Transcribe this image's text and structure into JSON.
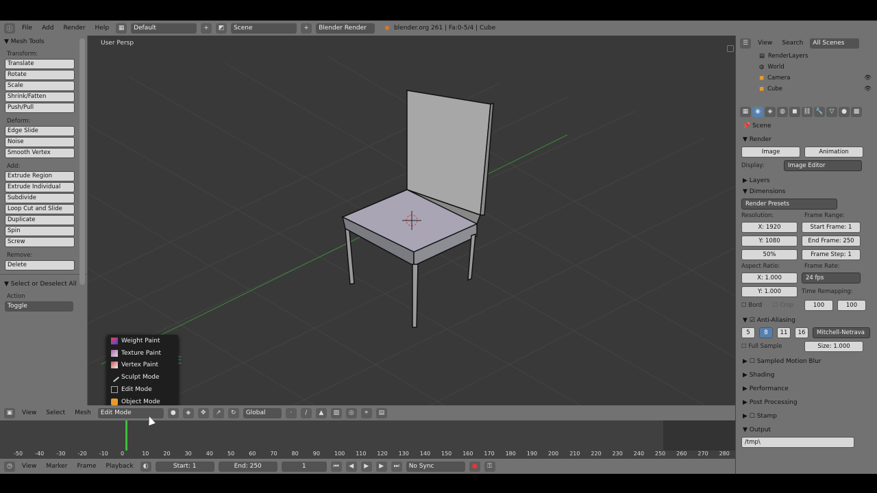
{
  "topbar": {
    "menus": [
      "File",
      "Add",
      "Render",
      "Help"
    ],
    "screen_layout": "Default",
    "scene": "Scene",
    "engine": "Blender Render",
    "info": "blender.org 261 | Fa:0-5/4 | Cube"
  },
  "toolshelf": {
    "title": "Mesh Tools",
    "transform_label": "Transform:",
    "transform": [
      "Translate",
      "Rotate",
      "Scale",
      "Shrink/Fatten",
      "Push/Pull"
    ],
    "deform_label": "Deform:",
    "deform": [
      "Edge Slide",
      "Noise",
      "Smooth Vertex"
    ],
    "add_label": "Add:",
    "add": [
      "Extrude Region",
      "Extrude Individual",
      "Subdivide",
      "Loop Cut and Slide",
      "Duplicate",
      "Spin",
      "Screw"
    ],
    "remove_label": "Remove:",
    "remove": [
      "Delete"
    ],
    "operator_title": "Select or Deselect All",
    "action_label": "Action",
    "action_value": "Toggle"
  },
  "viewport": {
    "label": "User Persp",
    "ghost_text": "E"
  },
  "mode_menu": {
    "items": [
      "Weight Paint",
      "Texture Paint",
      "Vertex Paint",
      "Sculpt Mode",
      "Edit Mode",
      "Object Mode"
    ]
  },
  "vp_header": {
    "menus": [
      "View",
      "Select",
      "Mesh"
    ],
    "mode": "Edit Mode",
    "orientation": "Global"
  },
  "timeline": {
    "ticks": [
      "-50",
      "-40",
      "-30",
      "-20",
      "-10",
      "0",
      "10",
      "20",
      "30",
      "40",
      "50",
      "60",
      "70",
      "80",
      "90",
      "100",
      "110",
      "120",
      "130",
      "140",
      "150",
      "160",
      "170",
      "180",
      "190",
      "200",
      "210",
      "220",
      "230",
      "240",
      "250",
      "260",
      "270",
      "280"
    ],
    "current_frame_marker": "1"
  },
  "tl_header": {
    "menus": [
      "View",
      "Marker",
      "Frame",
      "Playback"
    ],
    "start": "Start: 1",
    "end": "End: 250",
    "frame": "1",
    "sync": "No Sync"
  },
  "outliner": {
    "menus": [
      "View",
      "Search"
    ],
    "filter": "All Scenes",
    "items": [
      "RenderLayers",
      "World",
      "Camera",
      "Cube"
    ]
  },
  "props": {
    "context": "Scene",
    "render_title": "Render",
    "image_btn": "Image",
    "animation_btn": "Animation",
    "display_label": "Display:",
    "display_value": "Image Editor",
    "layers_title": "Layers",
    "dimensions_title": "Dimensions",
    "presets": "Render Presets",
    "resolution_label": "Resolution:",
    "res_x": "X: 1920",
    "res_y": "Y: 1080",
    "res_pct": "50%",
    "frame_range_label": "Frame Range:",
    "start_frame": "Start Frame: 1",
    "end_frame": "End Frame: 250",
    "frame_step": "Frame Step: 1",
    "aspect_label": "Aspect Ratio:",
    "aspect_x": "X: 1.000",
    "aspect_y": "Y: 1.000",
    "frame_rate_label": "Frame Rate:",
    "fps": "24 fps",
    "bord": "Bord",
    "crop": "Crop",
    "remap_label": "Time Remapping:",
    "remap_old": "100",
    "remap_new": "100",
    "aa_title": "Anti-Aliasing",
    "aa_samples": [
      "5",
      "8",
      "11",
      "16"
    ],
    "aa_filter": "Mitchell-Netrava",
    "full_sample": "Full Sample",
    "size": "Size: 1.000",
    "collapsed": [
      "Sampled Motion Blur",
      "Shading",
      "Performance",
      "Post Processing",
      "Stamp"
    ],
    "output_title": "Output",
    "output_path": "/tmp\\"
  }
}
